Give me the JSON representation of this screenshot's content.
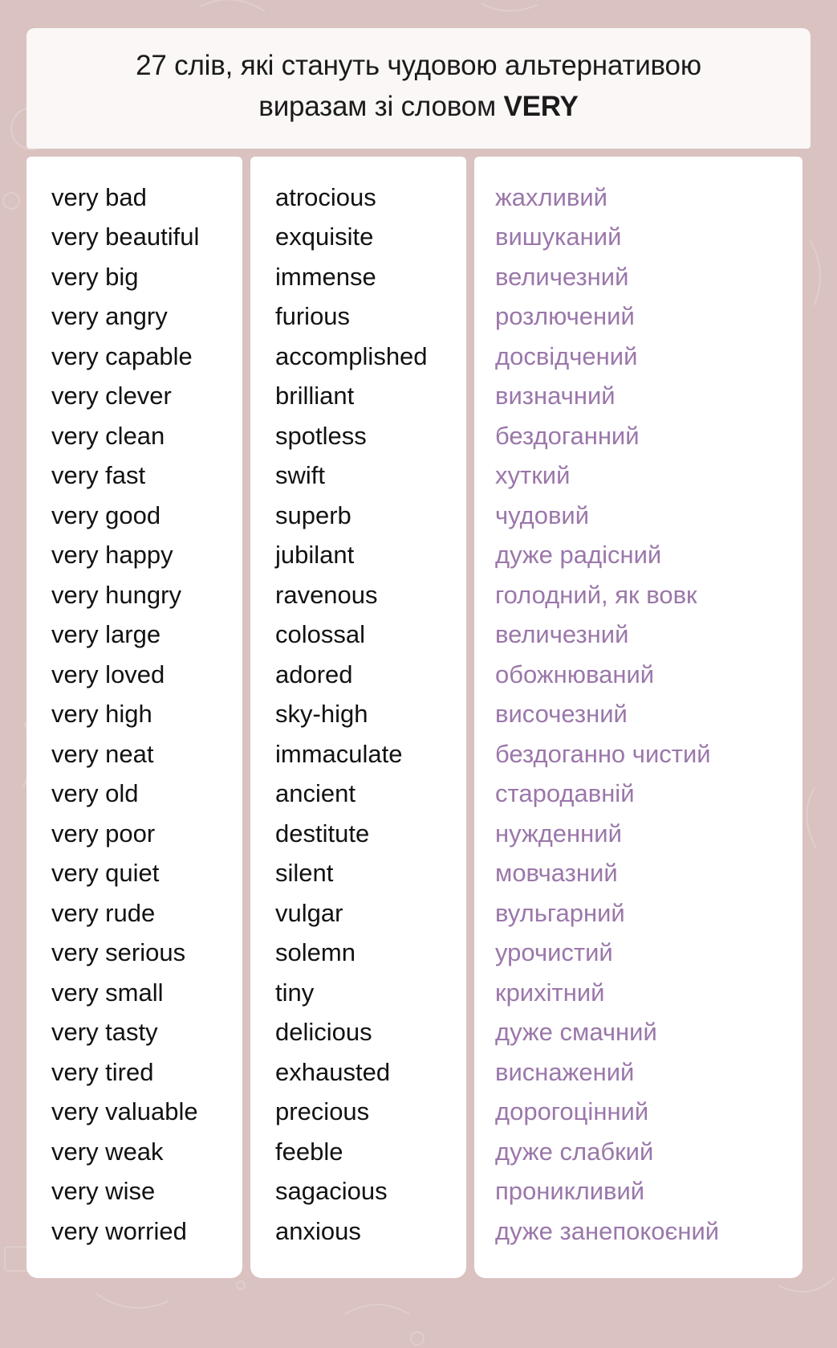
{
  "theme": {
    "background": "#d9c2c0",
    "card_background": "#ffffff",
    "title_card_background": "#faf7f6",
    "text_color": "#121212",
    "accent_color": "#9b77aa"
  },
  "header": {
    "title_line1": "27 слів, які стануть чудовою альтернативою",
    "title_line2_prefix": "виразам зі словом ",
    "title_line2_strong": "VERY"
  },
  "table": {
    "columns": [
      {
        "name": "very-phrase",
        "language": "en"
      },
      {
        "name": "synonym",
        "language": "en"
      },
      {
        "name": "translation",
        "language": "uk"
      }
    ],
    "rows": [
      {
        "phrase": "very bad",
        "synonym": "atrocious",
        "translation": "жахливий"
      },
      {
        "phrase": "very beautiful",
        "synonym": "exquisite",
        "translation": "вишуканий"
      },
      {
        "phrase": "very big",
        "synonym": "immense",
        "translation": "величезний"
      },
      {
        "phrase": "very angry",
        "synonym": "furious",
        "translation": "розлючений"
      },
      {
        "phrase": "very capable",
        "synonym": "accomplished",
        "translation": "досвідчений"
      },
      {
        "phrase": "very clever",
        "synonym": "brilliant",
        "translation": "визначний"
      },
      {
        "phrase": "very clean",
        "synonym": "spotless",
        "translation": "бездоганний"
      },
      {
        "phrase": "very fast",
        "synonym": "swift",
        "translation": "хуткий"
      },
      {
        "phrase": "very good",
        "synonym": "superb",
        "translation": "чудовий"
      },
      {
        "phrase": "very happy",
        "synonym": "jubilant",
        "translation": "дуже радісний"
      },
      {
        "phrase": "very hungry",
        "synonym": "ravenous",
        "translation": "голодний, як вовк"
      },
      {
        "phrase": "very large",
        "synonym": "colossal",
        "translation": "величезний"
      },
      {
        "phrase": "very loved",
        "synonym": "adored",
        "translation": "обожнюваний"
      },
      {
        "phrase": "very high",
        "synonym": "sky-high",
        "translation": "височезний"
      },
      {
        "phrase": "very neat",
        "synonym": "immaculate",
        "translation": "бездоганно чистий"
      },
      {
        "phrase": "very old",
        "synonym": "ancient",
        "translation": "стародавній"
      },
      {
        "phrase": "very poor",
        "synonym": "destitute",
        "translation": "нужденний"
      },
      {
        "phrase": "very quiet",
        "synonym": "silent",
        "translation": "мовчазний"
      },
      {
        "phrase": "very rude",
        "synonym": "vulgar",
        "translation": "вульгарний"
      },
      {
        "phrase": "very serious",
        "synonym": "solemn",
        "translation": "урочистий"
      },
      {
        "phrase": "very small",
        "synonym": "tiny",
        "translation": "крихітний"
      },
      {
        "phrase": "very tasty",
        "synonym": "delicious",
        "translation": "дуже смачний"
      },
      {
        "phrase": "very tired",
        "synonym": "exhausted",
        "translation": "виснажений"
      },
      {
        "phrase": "very valuable",
        "synonym": "precious",
        "translation": "дорогоцінний"
      },
      {
        "phrase": "very weak",
        "synonym": "feeble",
        "translation": "дуже слабкий"
      },
      {
        "phrase": "very wise",
        "synonym": "sagacious",
        "translation": "проникливий"
      },
      {
        "phrase": "very worried",
        "synonym": "anxious",
        "translation": "дуже занепокоєний"
      }
    ]
  }
}
